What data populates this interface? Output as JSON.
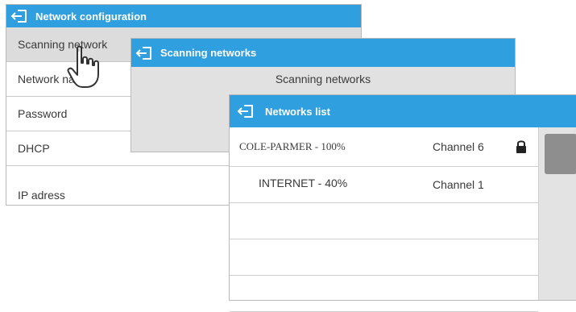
{
  "network_config": {
    "title": "Network configuration",
    "items": [
      {
        "label": "Scanning network"
      },
      {
        "label": "Network name"
      },
      {
        "label": "Password"
      },
      {
        "label": "DHCP"
      },
      {
        "label": "IP adress"
      }
    ]
  },
  "scanning": {
    "title": "Scanning networks",
    "status": "Scanning networks"
  },
  "networks_list": {
    "title": "Networks list",
    "rows": [
      {
        "name": "COLE-PARMER - 100%",
        "channel": "Channel 6",
        "locked": true
      },
      {
        "name": "INTERNET - 40%",
        "channel": "Channel 1",
        "locked": false
      },
      {
        "name": "",
        "channel": ""
      },
      {
        "name": "",
        "channel": ""
      },
      {
        "name": "",
        "channel": ""
      }
    ]
  },
  "icons": {
    "back": "back-arrow-icon",
    "lock": "lock-icon",
    "pointer": "hand-pointer-icon"
  },
  "colors": {
    "titlebar": "#2f9fe0",
    "selected_row": "#dcdcdc",
    "panel": "#e1e1e1"
  }
}
